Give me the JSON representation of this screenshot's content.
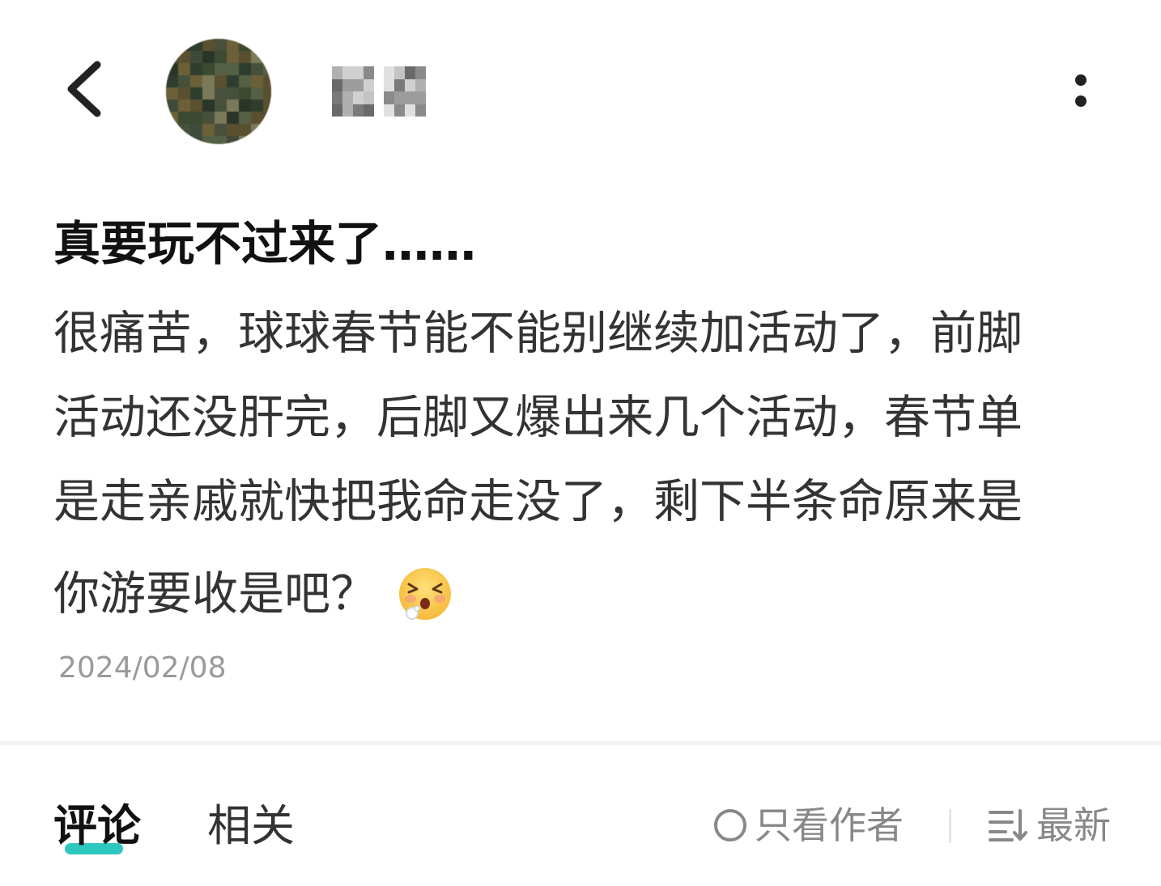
{
  "header": {
    "back_icon": "chevron-left-icon",
    "username": "",
    "more_icon": "vertical-more-icon"
  },
  "post": {
    "title": "真要玩不过来了……",
    "body_lines": [
      "很痛苦，球球春节能不能别继续加活动了，前脚",
      "活动还没肝完，后脚又爆出来几个活动，春节单",
      "是走亲戚就快把我命走没了，剩下半条命原来是",
      "你游要收是吧？"
    ],
    "emoji": "tired-face-emoji",
    "date": "2024/02/08"
  },
  "tabs": {
    "comments_label": "评论",
    "related_label": "相关",
    "only_author_label": "只看作者",
    "sort_label": "最新"
  },
  "colors": {
    "accent": "#2ec7c0",
    "text_primary": "#111111",
    "text_body": "#333333",
    "text_muted": "#9a9a9a"
  }
}
